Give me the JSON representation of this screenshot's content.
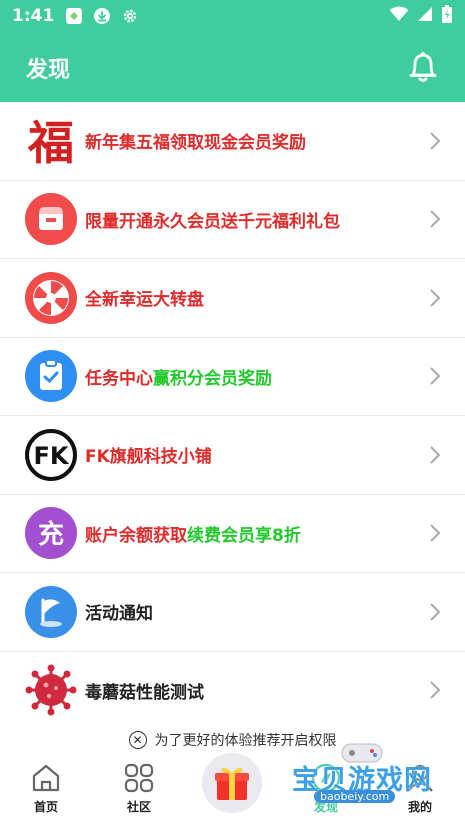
{
  "status_bar": {
    "time": "1:41"
  },
  "header": {
    "title": "发现"
  },
  "list": {
    "items": [
      {
        "label": "新年集五福领取现金会员奖励",
        "icon": "fu-character-icon",
        "accent": "#d32020"
      },
      {
        "label": "限量开通永久会员送千元福利礼包",
        "icon": "gift-bag-icon",
        "accent": "#f24b4b"
      },
      {
        "label": "全新幸运大转盘",
        "icon": "lucky-wheel-icon",
        "accent": "#f04b4b"
      },
      {
        "label_red": "任务中心",
        "label_green": "赢积分会员奖励",
        "icon": "task-clipboard-icon",
        "accent": "#2f8ef2"
      },
      {
        "label": "FK旗舰科技小铺",
        "icon": "fk-logo-icon",
        "accent": "#111111"
      },
      {
        "label_red": "账户余额获取",
        "label_green": "续费会员享8折",
        "icon": "recharge-icon",
        "icon_text": "充",
        "accent": "#a24fd0"
      },
      {
        "label": "活动通知",
        "icon": "flag-notice-icon",
        "accent": "#3a8fe8"
      },
      {
        "label": "毒蘑菇性能测试",
        "icon": "virus-icon",
        "accent": "#d0283c"
      }
    ]
  },
  "permission_bar": {
    "text": "为了更好的体验推荐开启权限"
  },
  "tabs": [
    {
      "label": "首页",
      "icon": "home-icon"
    },
    {
      "label": "社区",
      "icon": "grid-icon"
    },
    {
      "label": "",
      "icon": "gift-box-icon"
    },
    {
      "label": "发现",
      "icon": "discover-icon"
    },
    {
      "label": "我的",
      "icon": "profile-icon"
    }
  ],
  "watermark": {
    "text": "宝贝游戏网",
    "url": "baobeiy.com"
  }
}
